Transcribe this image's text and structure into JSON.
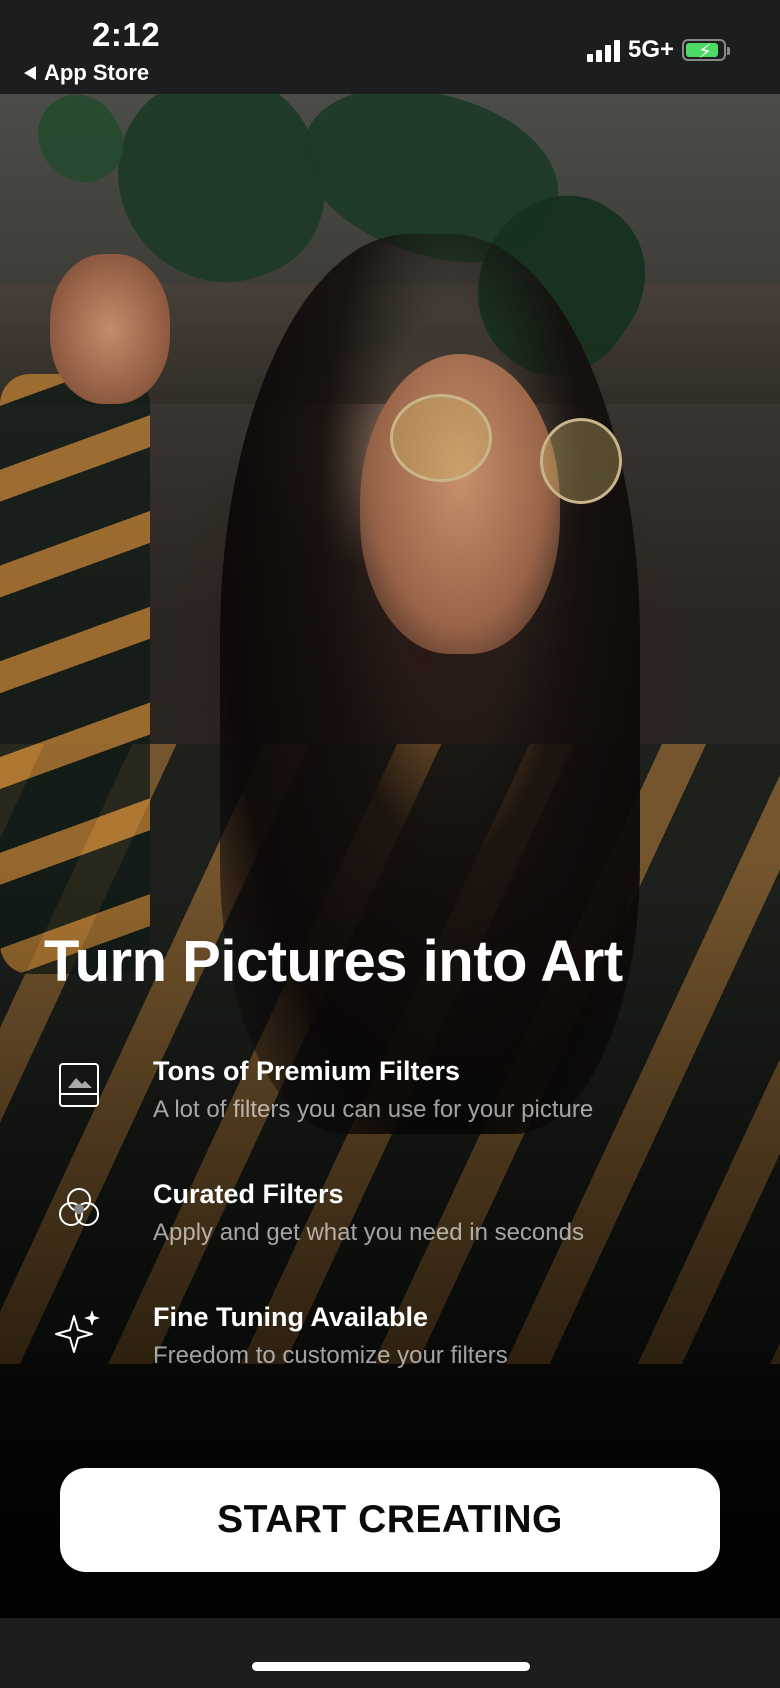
{
  "status_bar": {
    "time": "2:12",
    "back_label": "App Store",
    "network": "5G+",
    "battery_charging": true
  },
  "hero": {
    "description_icon": "portrait-photo"
  },
  "headline": "Turn Pictures into Art",
  "features": [
    {
      "icon": "image-frame-icon",
      "title": "Tons of Premium Filters",
      "subtitle": "A lot of filters you can use for your picture"
    },
    {
      "icon": "overlapping-circles-icon",
      "title": "Curated Filters",
      "subtitle": "Apply and get what you need in seconds"
    },
    {
      "icon": "sparkle-icon",
      "title": "Fine Tuning Available",
      "subtitle": "Freedom to customize your filters"
    }
  ],
  "cta": {
    "label": "START CREATING"
  },
  "colors": {
    "background": "#1c1d1e",
    "button": "#ffffff",
    "button_text": "#0b0b0b",
    "subtitle_text": "rgba(255,255,255,0.62)"
  }
}
